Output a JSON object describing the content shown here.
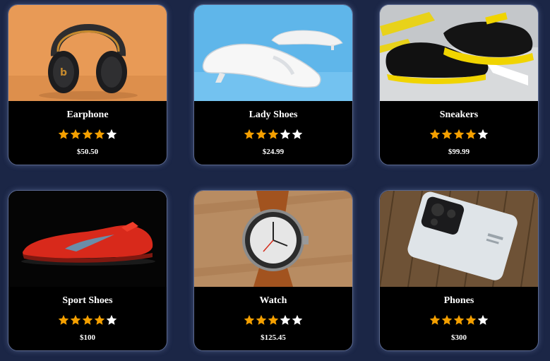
{
  "colors": {
    "background": "#1b2646",
    "card": "#000000",
    "star_filled": "#f5a000",
    "star_empty": "#ffffff"
  },
  "products": [
    {
      "name": "Earphone",
      "price": "$50.50",
      "rating": 4,
      "image": "headphones-image"
    },
    {
      "name": "Lady Shoes",
      "price": "$24.99",
      "rating": 3,
      "image": "white-flat-shoe-image"
    },
    {
      "name": "Sneakers",
      "price": "$99.99",
      "rating": 4,
      "image": "black-yellow-sneakers-image"
    },
    {
      "name": "Sport Shoes",
      "price": "$100",
      "rating": 4,
      "image": "red-running-shoe-image"
    },
    {
      "name": "Watch",
      "price": "$125.45",
      "rating": 3,
      "image": "wrist-watch-image"
    },
    {
      "name": "Phones",
      "price": "$300",
      "rating": 4,
      "image": "white-smartphone-image"
    }
  ]
}
